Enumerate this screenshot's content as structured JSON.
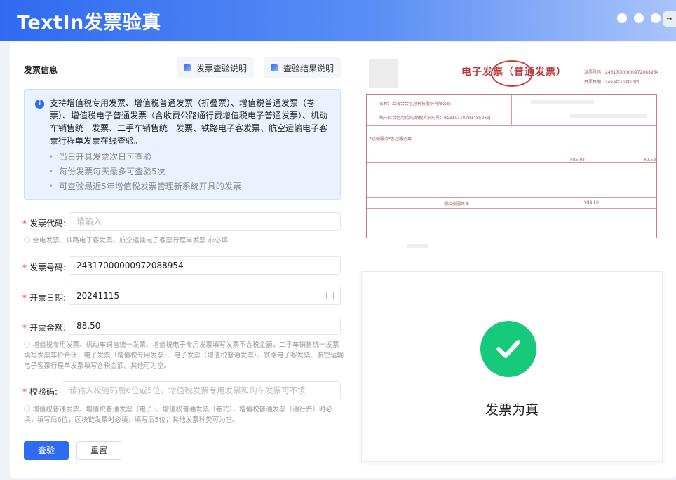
{
  "header": {
    "title": "TextIn发票验真"
  },
  "section_title": "发票信息",
  "top_buttons": {
    "check_desc": "发票查验说明",
    "result_desc": "查验结果说明"
  },
  "info": {
    "text": "支持增值税专用发票、增值税普通发票（折叠票）、增值税普通发票（卷票）、增值税电子普通发票（含收费公路通行费增值税电子普通发票）、机动车销售统一发票、二手车销售统一发票、铁路电子客发票、航空运输电子客票行程单发票在线查验。",
    "bullets": [
      "当日开具发票次日可查验",
      "每份发票每天最多可查验5次",
      "可查验最近5年增值税发票管理新系统开具的发票"
    ]
  },
  "form": {
    "invoice_code": {
      "label": "发票代码:",
      "placeholder": "请输入",
      "hint": "全电发票、铁路电子客发票、航空运输电子客票行程单发票 非必填"
    },
    "invoice_number": {
      "label": "发票号码:",
      "value": "24317000000972088954"
    },
    "issue_date": {
      "label": "开票日期:",
      "value": "20241115"
    },
    "amount": {
      "label": "开票金额:",
      "value": "88.50",
      "hint": "增值税专用发票、机动车销售统一发票、增值税电子专用发票填写发票不含税金额；二手车销售统一发票填写发票车价合计；电子发票（增值税专用发票）、电子发票（增值税普通发票）、铁路电子客发票、航空运输电子客票行程单发票填写含税金额。其他可为空。"
    },
    "check_code": {
      "label": "校验码:",
      "placeholder": "请输入校验码后6位或5位，增值税发票专用发票和购车发票可不填",
      "hint": "增值税普通发票、增值税普通发票（电子）、增值税普通发票（卷式）、增值税普通发票（通行费）时必填，填写后6位；区块链发票时必填，填写后5位；其他发票种类可为空。"
    },
    "submit_label": "查验",
    "reset_label": "重置"
  },
  "invoice_preview": {
    "title": "电子发票（普通发票）",
    "number_label": "发票号码：24317000000972088954",
    "date_label": "开票日期：2024年11月15日",
    "buyer_name": "名称：上海合合信息科技股份有限公司",
    "buyer_tax": "统一社会信用代码/纳税人识别号：91310110791485269J",
    "item_name": "*运输服务*客运服务费",
    "total_amount": "¥85.92",
    "total_tax": "¥2.58",
    "amount_words": "捌拾捌圆伍角",
    "small_total": "¥88.50"
  },
  "result": {
    "text": "发票为真"
  },
  "colors": {
    "primary": "#2f6bf0",
    "success": "#17c97b",
    "required": "#e53935"
  }
}
